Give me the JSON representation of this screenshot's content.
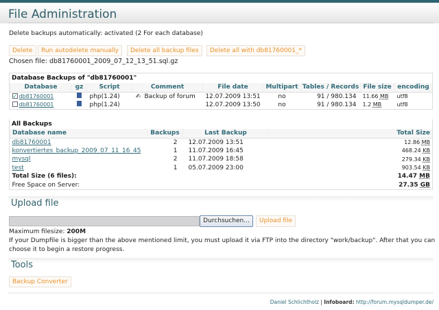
{
  "title": "File Administration",
  "autodelete_text": "Delete backups automatically: activated (2 For each database)",
  "buttons": {
    "delete": "Delete",
    "run_autodelete": "Run autodelete manually",
    "delete_all": "Delete all backup files",
    "delete_all_with": "Delete all with db81760001_*"
  },
  "chosen_file": "Chosen file: db81760001_2009_07_12_13_51.sql.gz",
  "db_backups": {
    "title": "Database Backups of \"db81760001\"",
    "headers": [
      "Database",
      "gz",
      "Script",
      "Comment",
      "File date",
      "Multipart",
      "Tables / Records",
      "File size",
      "encoding"
    ],
    "rows": [
      {
        "checked": true,
        "database": "db81760001",
        "script": "php(1.24)",
        "comment": "Backup of forum",
        "has_comment_icon": true,
        "date": "12.07.2009 13:51",
        "multipart": "no",
        "records": "91 / 980.134",
        "size": "11.66",
        "unit": "MB",
        "encoding": "utf8"
      },
      {
        "checked": false,
        "database": "db81760001",
        "script": "php(1.24)",
        "comment": "",
        "has_comment_icon": false,
        "date": "12.07.2009 13:50",
        "multipart": "no",
        "records": "91 / 980.134",
        "size": "1.2",
        "unit": "MB",
        "encoding": "utf8"
      }
    ]
  },
  "all_backups": {
    "title": "All Backups",
    "headers": [
      "Database name",
      "Backups",
      "Last Backup",
      "Total Size"
    ],
    "rows": [
      {
        "name": "db81760001",
        "count": "2",
        "last": "12.07.2009 13:51",
        "size": "12.86",
        "unit": "MB"
      },
      {
        "name": "konvertiertes_backup_2009_07_11_16_45",
        "count": "1",
        "last": "11.07.2009 16:45",
        "size": "468.24",
        "unit": "KB"
      },
      {
        "name": "mysql",
        "count": "2",
        "last": "11.07.2009 18:58",
        "size": "279.34",
        "unit": "KB"
      },
      {
        "name": "test",
        "count": "1",
        "last": "05.07.2009 23:00",
        "size": "903.54",
        "unit": "KB"
      }
    ],
    "total_label": "Total Size (6 files):",
    "total_value": "14.47",
    "total_unit": "MB",
    "free_label": "Free Space on Server:",
    "free_value": "27.35",
    "free_unit": "GB"
  },
  "upload": {
    "heading": "Upload file",
    "file_value": "",
    "browse": "Durchsuchen...",
    "submit": "Upload file",
    "max_label": "Maximum filesize:",
    "max_value": "200M",
    "note": "If your Dumpfile is bigger than the above mentioned limit, you must upload it via FTP into the directory \"work/backup\". After that you can choose it to begin a restore progress."
  },
  "tools": {
    "heading": "Tools",
    "converter": "Backup Converter"
  },
  "footer": {
    "author": "Daniel Schlichtholz",
    "sep": " | ",
    "label": "Infoboard:",
    "url": "http://forum.mysqldumper.de/"
  }
}
